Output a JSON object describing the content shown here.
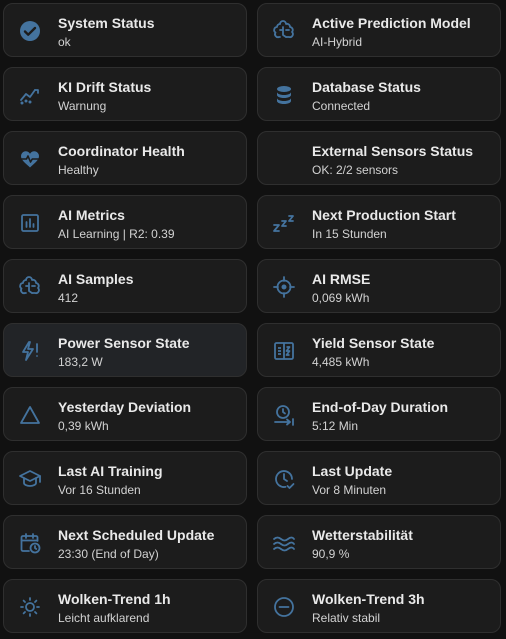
{
  "accent_color": "#44739e",
  "cards": [
    {
      "title": "System Status",
      "value": "ok",
      "icon": "check-circle-icon"
    },
    {
      "title": "Active Prediction Model",
      "value": "AI-Hybrid",
      "icon": "brain-icon"
    },
    {
      "title": "KI Drift Status",
      "value": "Warnung",
      "icon": "trend-chart-icon"
    },
    {
      "title": "Database Status",
      "value": "Connected",
      "icon": "database-icon"
    },
    {
      "title": "Coordinator Health",
      "value": "Healthy",
      "icon": "heart-pulse-icon"
    },
    {
      "title": "External Sensors Status",
      "value": "OK: 2/2 sensors",
      "icon": ""
    },
    {
      "title": "AI Metrics",
      "value": "AI Learning | R2: 0.39",
      "icon": "bar-chart-icon"
    },
    {
      "title": "Next Production Start",
      "value": "In 15 Stunden",
      "icon": "sleep-zzz-icon"
    },
    {
      "title": "AI Samples",
      "value": "412",
      "icon": "brain-icon"
    },
    {
      "title": "AI RMSE",
      "value": "0,069 kWh",
      "icon": "crosshair-icon"
    },
    {
      "title": "Power Sensor State",
      "value": "183,2 W",
      "icon": "flash-alert-icon"
    },
    {
      "title": "Yield Sensor State",
      "value": "4,485 kWh",
      "icon": "meter-icon"
    },
    {
      "title": "Yesterday Deviation",
      "value": "0,39 kWh",
      "icon": "triangle-icon"
    },
    {
      "title": "End-of-Day Duration",
      "value": "5:12 Min",
      "icon": "clock-arrow-icon"
    },
    {
      "title": "Last AI Training",
      "value": "Vor 16 Stunden",
      "icon": "graduation-cap-icon"
    },
    {
      "title": "Last Update",
      "value": "Vor 8 Minuten",
      "icon": "clock-check-icon"
    },
    {
      "title": "Next Scheduled Update",
      "value": "23:30 (End of Day)",
      "icon": "calendar-clock-icon"
    },
    {
      "title": "Wetterstabilität",
      "value": "90,9 %",
      "icon": "waves-icon"
    },
    {
      "title": "Wolken-Trend 1h",
      "value": "Leicht aufklarend",
      "icon": "sun-outline-icon"
    },
    {
      "title": "Wolken-Trend 3h",
      "value": "Relativ stabil",
      "icon": "minus-circle-icon"
    }
  ]
}
